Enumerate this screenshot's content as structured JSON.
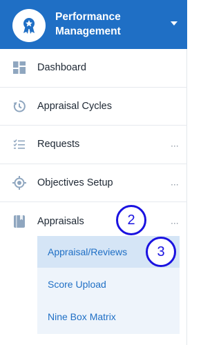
{
  "header": {
    "title": "Performance Management",
    "logo_icon": "award-badge-icon",
    "caret_icon": "chevron-down-icon"
  },
  "nav": {
    "items": [
      {
        "label": "Dashboard",
        "icon": "dashboard-grid-icon",
        "more": ""
      },
      {
        "label": "Appraisal Cycles",
        "icon": "cycle-clock-icon",
        "more": ""
      },
      {
        "label": "Requests",
        "icon": "checklist-icon",
        "more": "..."
      },
      {
        "label": "Objectives Setup",
        "icon": "target-icon",
        "more": "..."
      },
      {
        "label": "Appraisals",
        "icon": "book-icon",
        "more": "..."
      }
    ],
    "submenu": [
      {
        "label": "Appraisal/Reviews"
      },
      {
        "label": "Score Upload"
      },
      {
        "label": "Nine Box Matrix"
      }
    ]
  },
  "annotations": {
    "badge_2": "2",
    "badge_3": "3"
  },
  "colors": {
    "brand": "#1f6fc5",
    "active_bg": "#d5e5f6",
    "submenu_bg": "#eef4fb",
    "annotation": "#1a12e0"
  }
}
